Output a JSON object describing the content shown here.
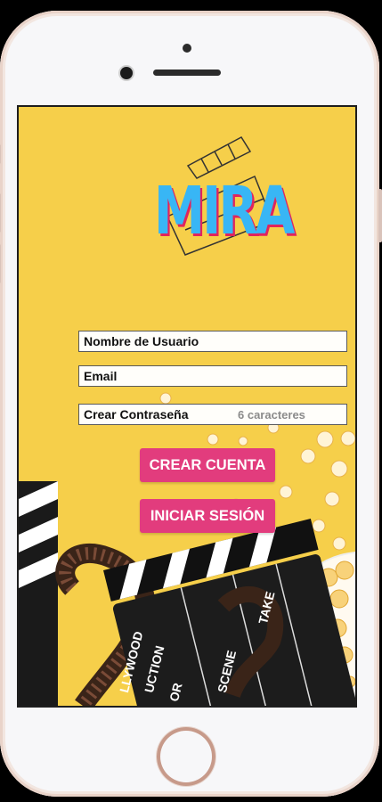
{
  "app": {
    "logo_text": "MIRA",
    "colors": {
      "background": "#f6cf4a",
      "logo": "#38b6f5",
      "logo_shadow": "#e0245e",
      "button": "#e23c7d"
    }
  },
  "form": {
    "username_label": "Nombre de Usuario",
    "email_label": "Email",
    "password_label": "Crear Contraseña",
    "password_hint": "6 caracteres",
    "create_account_button": "CREAR CUENTA",
    "login_button": "INICIAR SESIÓN"
  },
  "scene": {
    "clapper_labels": [
      "LLYWOOD",
      "UCTION",
      "OR",
      "SCENE",
      "TAKE"
    ]
  }
}
